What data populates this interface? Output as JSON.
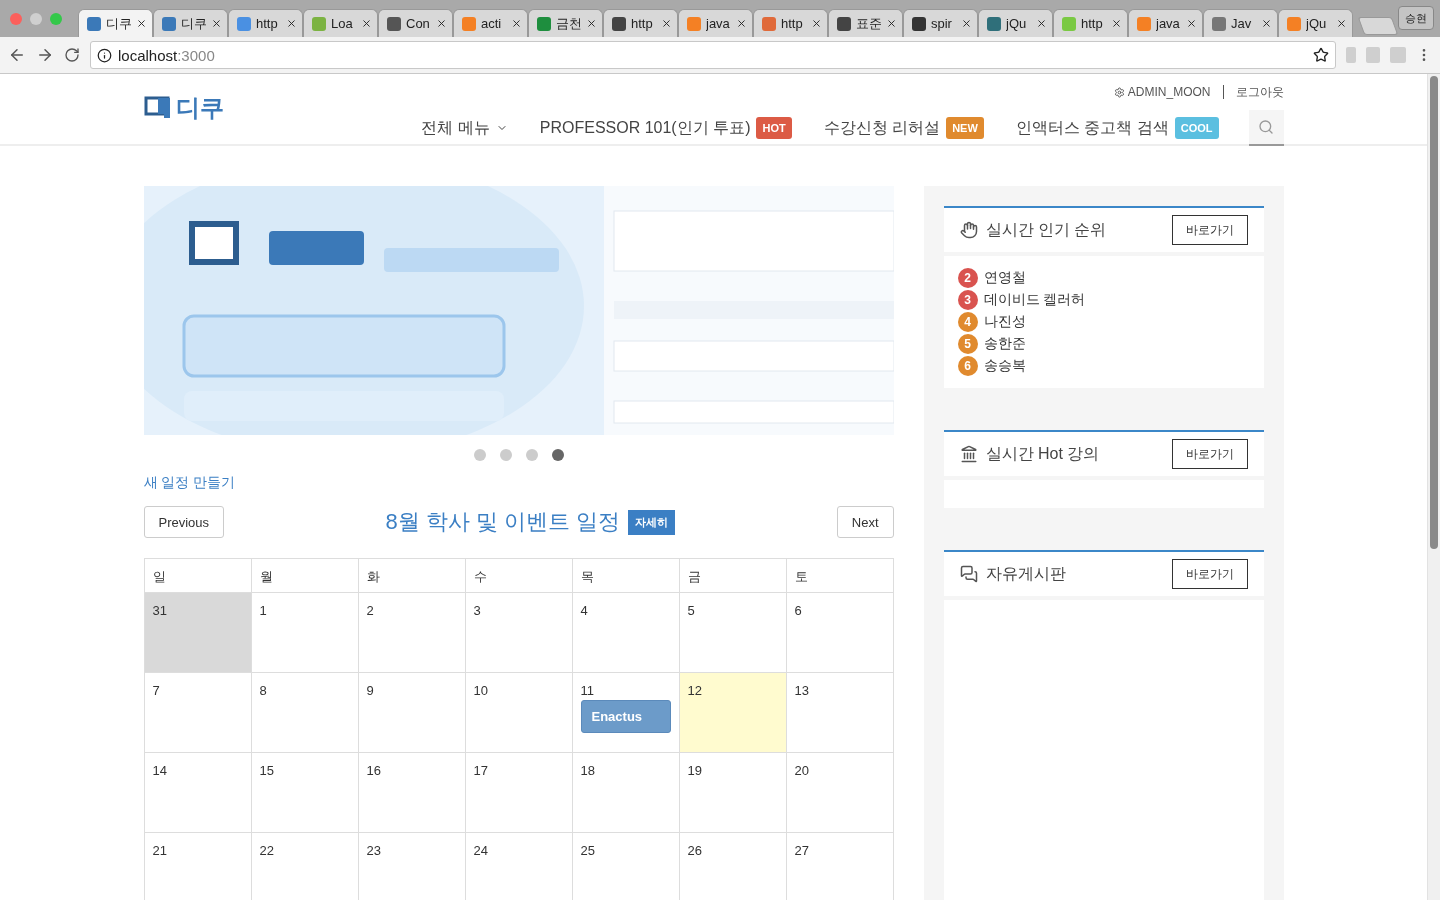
{
  "browser": {
    "tabs": [
      {
        "title": "디쿠",
        "selected": true,
        "color": "#3b79b8"
      },
      {
        "title": "디쿠",
        "selected": false,
        "color": "#3b79b8"
      },
      {
        "title": "http",
        "selected": false,
        "color": "#4a90e2"
      },
      {
        "title": "Loa",
        "selected": false,
        "color": "#7cb342"
      },
      {
        "title": "Con",
        "selected": false,
        "color": "#555555"
      },
      {
        "title": "acti",
        "selected": false,
        "color": "#f48024"
      },
      {
        "title": "금천",
        "selected": false,
        "color": "#1e8e3e"
      },
      {
        "title": "http",
        "selected": false,
        "color": "#444444"
      },
      {
        "title": "java",
        "selected": false,
        "color": "#f48024"
      },
      {
        "title": "http",
        "selected": false,
        "color": "#e06a3a"
      },
      {
        "title": "표준",
        "selected": false,
        "color": "#444444"
      },
      {
        "title": "spir",
        "selected": false,
        "color": "#333333"
      },
      {
        "title": "jQu",
        "selected": false,
        "color": "#2f6f7a"
      },
      {
        "title": "http",
        "selected": false,
        "color": "#7ac943"
      },
      {
        "title": "java",
        "selected": false,
        "color": "#f48024"
      },
      {
        "title": "Jav",
        "selected": false,
        "color": "#777777"
      },
      {
        "title": "jQu",
        "selected": false,
        "color": "#f48024"
      }
    ],
    "profile": "승현",
    "url_host": "localhost",
    "url_port": ":3000"
  },
  "header": {
    "logo": "디쿠",
    "user": "ADMIN_MOON",
    "logout": "로그아웃",
    "nav": [
      {
        "label": "전체 메뉴",
        "kind": "dropdown"
      },
      {
        "label": "PROFESSOR 101(인기 투표)",
        "kind": "badge",
        "badge": "HOT",
        "color": "#dc5b45"
      },
      {
        "label": "수강신청 리허설",
        "kind": "badge",
        "badge": "NEW",
        "color": "#e08a2e"
      },
      {
        "label": "인액터스 중고책 검색",
        "kind": "badge",
        "badge": "COOL",
        "color": "#5bbfe0"
      }
    ]
  },
  "carousel": {
    "kind": "picture",
    "dots": [
      {
        "selected": false
      },
      {
        "selected": false
      },
      {
        "selected": false
      },
      {
        "selected": true
      }
    ]
  },
  "new_event": "새 일정 만들기",
  "calendar": {
    "previous": "Previous",
    "title": "8월 학사 및 이벤트 일정",
    "detail": "자세히",
    "next": "Next",
    "weekdays": [
      "일",
      "월",
      "화",
      "수",
      "목",
      "금",
      "토"
    ],
    "weeks": [
      [
        {
          "day": "31",
          "outside": true,
          "today": false
        },
        {
          "day": "1",
          "outside": false,
          "today": false
        },
        {
          "day": "2",
          "outside": false,
          "today": false
        },
        {
          "day": "3",
          "outside": false,
          "today": false
        },
        {
          "day": "4",
          "outside": false,
          "today": false
        },
        {
          "day": "5",
          "outside": false,
          "today": false
        },
        {
          "day": "6",
          "outside": false,
          "today": false
        }
      ],
      [
        {
          "day": "7",
          "outside": false,
          "today": false
        },
        {
          "day": "8",
          "outside": false,
          "today": false
        },
        {
          "day": "9",
          "outside": false,
          "today": false
        },
        {
          "day": "10",
          "outside": false,
          "today": false
        },
        {
          "day": "11",
          "outside": false,
          "today": false,
          "events": [
            "Enactus"
          ]
        },
        {
          "day": "12",
          "outside": false,
          "today": true
        },
        {
          "day": "13",
          "outside": false,
          "today": false
        }
      ],
      [
        {
          "day": "14",
          "outside": false,
          "today": false
        },
        {
          "day": "15",
          "outside": false,
          "today": false
        },
        {
          "day": "16",
          "outside": false,
          "today": false
        },
        {
          "day": "17",
          "outside": false,
          "today": false
        },
        {
          "day": "18",
          "outside": false,
          "today": false
        },
        {
          "day": "19",
          "outside": false,
          "today": false
        },
        {
          "day": "20",
          "outside": false,
          "today": false
        }
      ],
      [
        {
          "day": "21",
          "outside": false,
          "today": false
        },
        {
          "day": "22",
          "outside": false,
          "today": false
        },
        {
          "day": "23",
          "outside": false,
          "today": false
        },
        {
          "day": "24",
          "outside": false,
          "today": false
        },
        {
          "day": "25",
          "outside": false,
          "today": false
        },
        {
          "day": "26",
          "outside": false,
          "today": false
        },
        {
          "day": "27",
          "outside": false,
          "today": false
        }
      ]
    ]
  },
  "sidebar": [
    {
      "kind": "ranking",
      "title": "실시간 인기 순위",
      "button": "바로가기",
      "items": [
        {
          "rank": "2",
          "name": "연영철",
          "color": "#d9534f"
        },
        {
          "rank": "3",
          "name": "데이비드 켈러허",
          "color": "#d9534f"
        },
        {
          "rank": "4",
          "name": "나진성",
          "color": "#e08a2e"
        },
        {
          "rank": "5",
          "name": "송한준",
          "color": "#e08a2e"
        },
        {
          "rank": "6",
          "name": "송승복",
          "color": "#e08a2e"
        }
      ]
    },
    {
      "kind": "lectures",
      "title": "실시간 Hot 강의",
      "button": "바로가기"
    },
    {
      "kind": "board",
      "title": "자유게시판",
      "button": "바로가기"
    }
  ]
}
